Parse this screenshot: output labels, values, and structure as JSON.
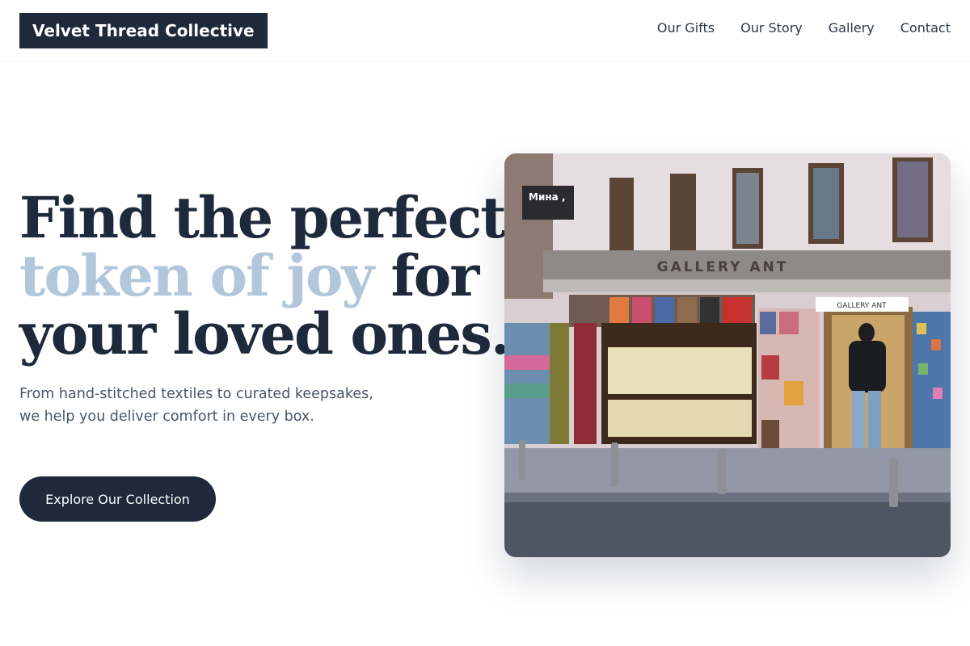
{
  "header": {
    "logo": "Velvet Thread Collective",
    "nav": [
      {
        "label": "Our Gifts"
      },
      {
        "label": "Our Story"
      },
      {
        "label": "Gallery"
      },
      {
        "label": "Contact"
      }
    ]
  },
  "hero": {
    "title_part1": "Find the perfect",
    "title_accent": "token of joy",
    "title_part2": " for",
    "title_part3": "your loved ones.",
    "subtitle": "From hand-stitched textiles to curated keepsakes, we help you deliver comfort in every box.",
    "cta_label": "Explore Our Collection"
  },
  "photo": {
    "shop_sign": "GALLERY ANT",
    "small_sign": "GALLERY ANT",
    "corner_sign": "Мина ,"
  },
  "colors": {
    "primary": "#1e293b",
    "accent": "#b3c7dc",
    "muted_text": "#4a5568"
  }
}
